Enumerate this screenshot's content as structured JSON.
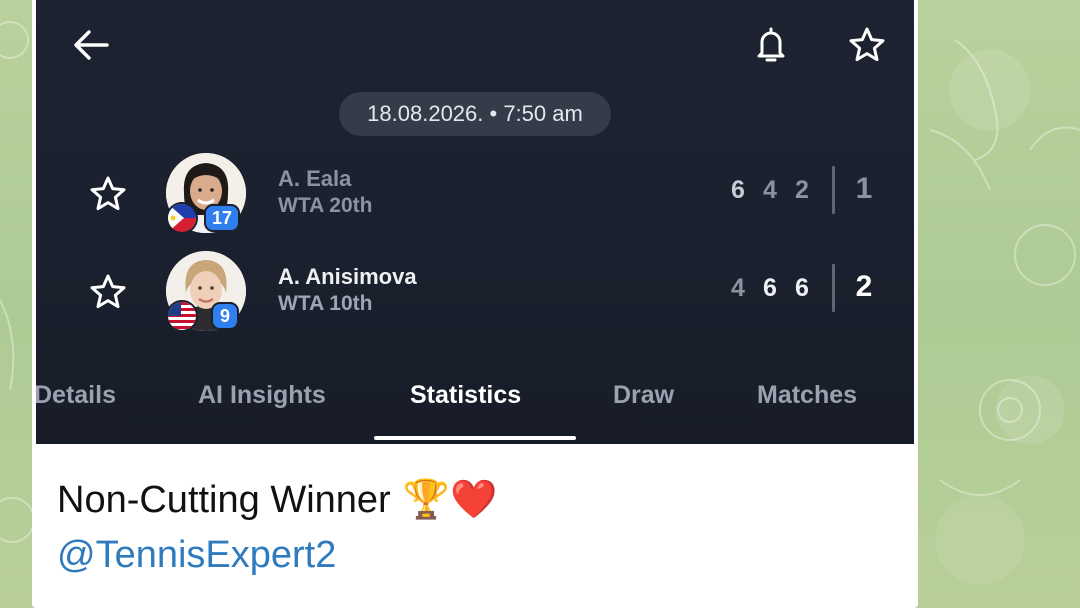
{
  "header": {
    "back_icon": "arrow-left-icon",
    "bell_icon": "bell-icon",
    "favorite_icon": "star-outline-icon"
  },
  "match": {
    "datetime": "18.08.2026. • 7:50 am",
    "players": [
      {
        "name": "A. Eala",
        "rank": "WTA 20th",
        "seed": "17",
        "flag": "Philippines",
        "sets": [
          "6",
          "4",
          "2"
        ],
        "sets_won": "1"
      },
      {
        "name": "A. Anisimova",
        "rank": "WTA 10th",
        "seed": "9",
        "flag": "United States",
        "sets": [
          "4",
          "6",
          "6"
        ],
        "sets_won": "2"
      }
    ]
  },
  "tabs": [
    {
      "label": "Details",
      "active": false
    },
    {
      "label": "AI Insights",
      "active": false
    },
    {
      "label": "Statistics",
      "active": true
    },
    {
      "label": "Draw",
      "active": false
    },
    {
      "label": "Matches",
      "active": false
    }
  ],
  "caption": {
    "text": "Non-Cutting Winner",
    "emoji": "🏆❤️",
    "mention": "@TennisExpert2"
  },
  "colors": {
    "panel": "#1a202d",
    "seed_badge": "#2f7fef",
    "mention_link": "#2f7bbd",
    "chat_background": "#b7cf9b"
  }
}
